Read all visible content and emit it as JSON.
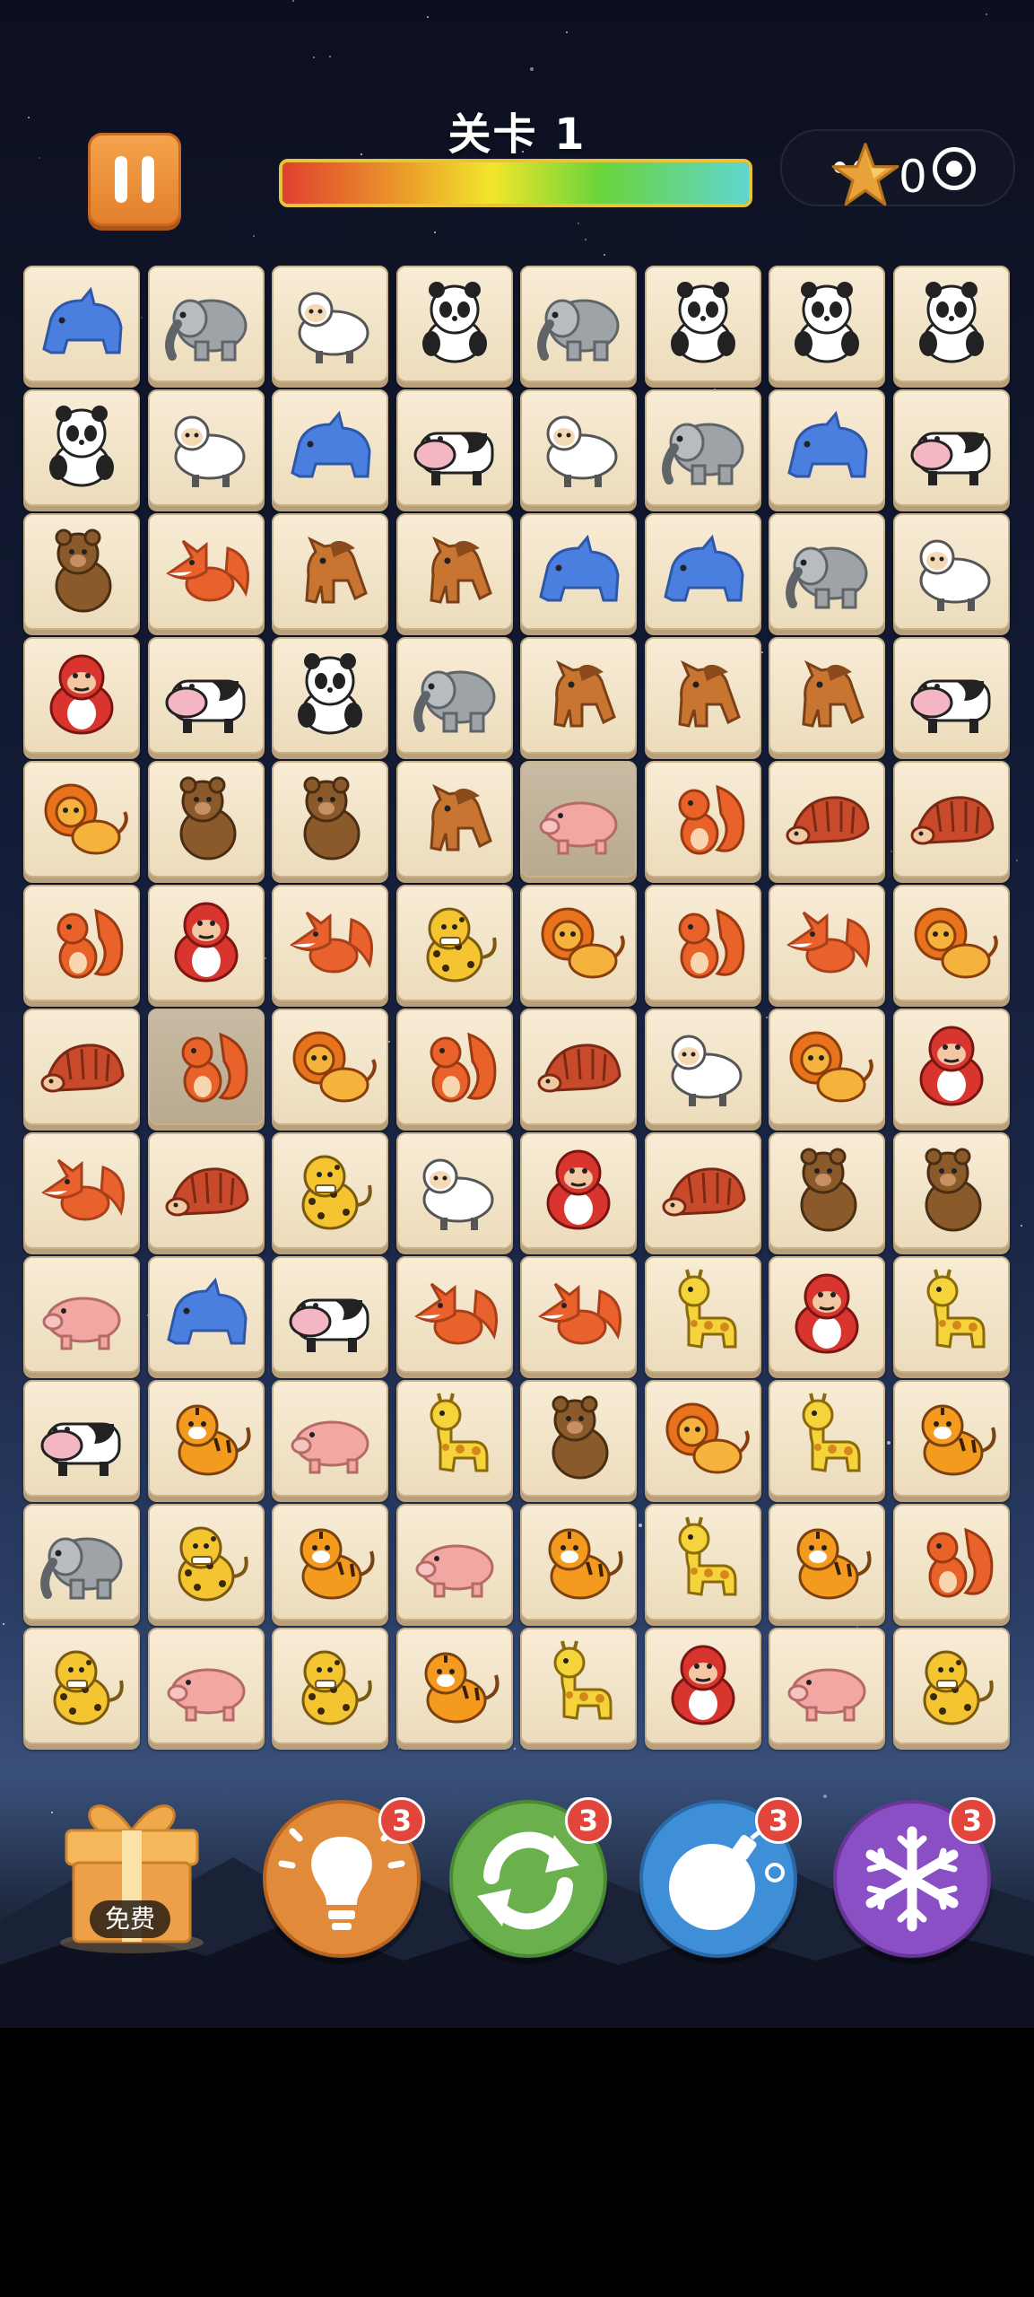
{
  "header": {
    "level_title": "关卡 1",
    "progress_fraction": 1.0,
    "star_count": "0"
  },
  "board": {
    "rows": [
      [
        "rhino",
        "elephant",
        "sheep",
        "panda",
        "elephant",
        "panda",
        "panda",
        "panda"
      ],
      [
        "panda",
        "sheep",
        "rhino",
        "cow",
        "sheep",
        "elephant",
        "rhino",
        "cow"
      ],
      [
        "bear",
        "fox",
        "horse",
        "horse",
        "rhino",
        "rhino",
        "elephant",
        "sheep"
      ],
      [
        "gorilla",
        "cow",
        "panda",
        "elephant",
        "horse",
        "horse",
        "horse",
        "cow"
      ],
      [
        "lion",
        "bear",
        "bear",
        "horse",
        "pig",
        "squirrel",
        "hedgehog",
        "hedgehog"
      ],
      [
        "squirrel",
        "gorilla",
        "fox",
        "leopard",
        "lion",
        "squirrel",
        "fox",
        "lion"
      ],
      [
        "hedgehog",
        "squirrel",
        "lion",
        "squirrel",
        "hedgehog",
        "sheep",
        "lion",
        "gorilla"
      ],
      [
        "fox",
        "hedgehog",
        "leopard",
        "sheep",
        "gorilla",
        "hedgehog",
        "bear",
        "bear"
      ],
      [
        "pig",
        "rhino",
        "cow",
        "fox",
        "fox",
        "giraffe",
        "gorilla",
        "giraffe"
      ],
      [
        "cow",
        "tiger",
        "pig",
        "giraffe",
        "bear",
        "lion",
        "giraffe",
        "tiger"
      ],
      [
        "elephant",
        "leopard",
        "tiger",
        "pig",
        "tiger",
        "giraffe",
        "tiger",
        "squirrel"
      ],
      [
        "leopard",
        "pig",
        "leopard",
        "tiger",
        "giraffe",
        "gorilla",
        "pig",
        "leopard"
      ]
    ],
    "dimmed_tiles": [
      [
        4,
        4
      ],
      [
        6,
        1
      ]
    ]
  },
  "tools": {
    "gift_label": "免费",
    "items": [
      {
        "name": "hint",
        "icon": "lightbulb-icon",
        "color": "#e08a3a",
        "badge": "3"
      },
      {
        "name": "shuffle",
        "icon": "refresh-icon",
        "color": "#6ab04c",
        "badge": "3"
      },
      {
        "name": "bomb",
        "icon": "bomb-icon",
        "color": "#3f8fd8",
        "badge": "3"
      },
      {
        "name": "freeze",
        "icon": "snowflake-icon",
        "color": "#8a4fc4",
        "badge": "3"
      }
    ]
  }
}
